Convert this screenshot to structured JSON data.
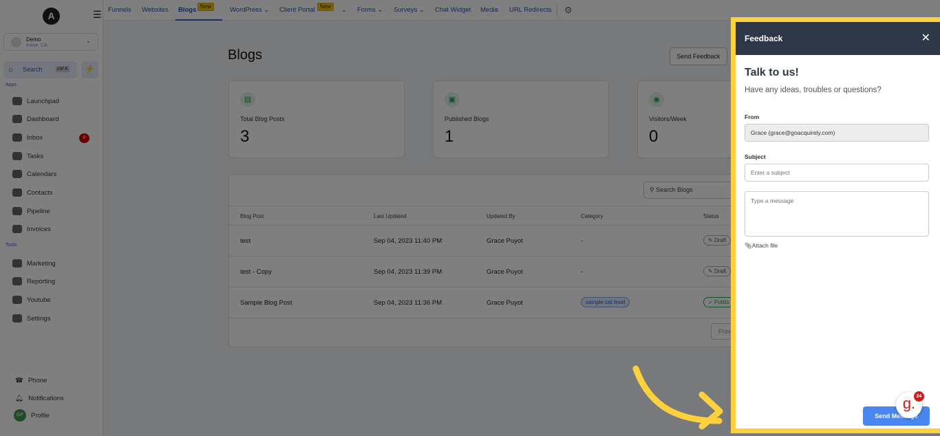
{
  "sidebar": {
    "logo": "A",
    "location": {
      "name": "Demo",
      "city": "Irvine, CA"
    },
    "search": {
      "label": "Search",
      "shortcut": "ctrl K"
    },
    "apps_label": "Apps",
    "tools_label": "Tools",
    "apps": [
      {
        "label": "Launchpad"
      },
      {
        "label": "Dashboard"
      },
      {
        "label": "Inbox",
        "badge": "0"
      },
      {
        "label": "Tasks"
      },
      {
        "label": "Calendars"
      },
      {
        "label": "Contacts"
      },
      {
        "label": "Pipeline"
      },
      {
        "label": "Invoices"
      }
    ],
    "tools": [
      {
        "label": "Marketing"
      },
      {
        "label": "Reporting"
      },
      {
        "label": "Youtube"
      },
      {
        "label": "Settings"
      }
    ],
    "bottom": {
      "phone": "Phone",
      "notifications": "Notifications",
      "profile": "Profile",
      "initials": "GP"
    }
  },
  "topnav": {
    "tabs": [
      {
        "label": "Funnels"
      },
      {
        "label": "Websites"
      },
      {
        "label": "Blogs",
        "badge": "New",
        "active": true
      },
      {
        "label": "WordPress"
      },
      {
        "label": "Client Portal",
        "badge": "New"
      },
      {
        "label": "Forms"
      },
      {
        "label": "Surveys"
      },
      {
        "label": "Chat Widget"
      },
      {
        "label": "Media"
      },
      {
        "label": "URL Redirects"
      }
    ]
  },
  "main": {
    "title": "Blogs",
    "send_feedback": "Send Feedback",
    "stats": [
      {
        "label": "Total Blog Posts",
        "value": "3",
        "icon": "document-icon"
      },
      {
        "label": "Published Blogs",
        "value": "1",
        "icon": "image-icon"
      },
      {
        "label": "Visitors/Week",
        "value": "0",
        "icon": "eye-icon"
      }
    ],
    "search_placeholder": "Search Blogs",
    "columns": [
      "Blog Post",
      "Last Updated",
      "Updated By",
      "Category",
      "Status"
    ],
    "rows": [
      {
        "post": "test",
        "updated": "Sep 04, 2023 11:40 PM",
        "by": "Grace Puyot",
        "category": "-",
        "status": "Draft"
      },
      {
        "post": "test - Copy",
        "updated": "Sep 04, 2023 11:39 PM",
        "by": "Grace Puyot",
        "category": "-",
        "status": "Draft"
      },
      {
        "post": "Sample Blog Post",
        "updated": "Sep 04, 2023 11:36 PM",
        "by": "Grace Puyot",
        "category": "sample cat level",
        "status": "Publis"
      }
    ],
    "prev": "Prev"
  },
  "feedback": {
    "title": "Feedback",
    "heading": "Talk to us!",
    "sub": "Have any ideas, troubles or questions?",
    "from_label": "From",
    "from_value": "Grace (grace@goacquirely.com)",
    "subject_label": "Subject",
    "subject_placeholder": "Enter a subject",
    "message_placeholder": "Type a message",
    "attach": "Attach file",
    "send": "Send Message"
  },
  "widget": {
    "letter": "g.",
    "count": "24"
  },
  "colors": {
    "highlight": "#fdd13e",
    "accent": "#2d5fd0",
    "panel_header": "#2d3748"
  }
}
